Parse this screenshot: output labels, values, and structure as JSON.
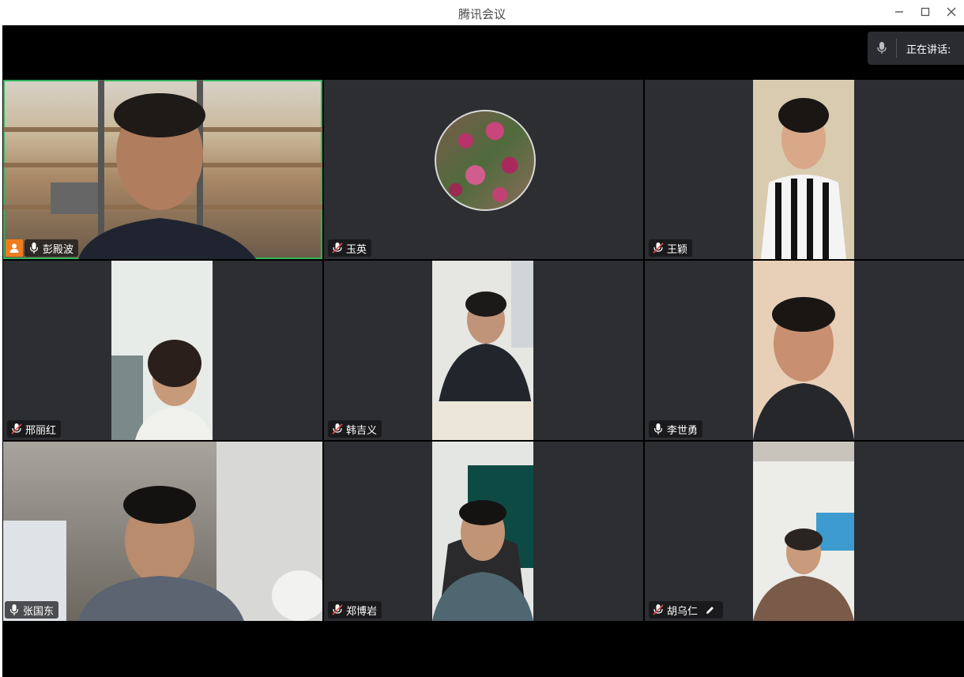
{
  "window": {
    "title": "腾讯会议",
    "minimize_icon": "minimize-icon",
    "maximize_icon": "maximize-icon",
    "close_icon": "close-icon"
  },
  "speaking": {
    "label": "正在讲话:",
    "icon": "mic-icon"
  },
  "participants": [
    {
      "name": "彭殿波",
      "mic": "on",
      "host": true,
      "active": true
    },
    {
      "name": "玉英",
      "mic": "muted",
      "avatar": true
    },
    {
      "name": "王颖",
      "mic": "muted"
    },
    {
      "name": "邢丽红",
      "mic": "muted"
    },
    {
      "name": "韩吉义",
      "mic": "muted"
    },
    {
      "name": "李世勇",
      "mic": "on"
    },
    {
      "name": "张国东",
      "mic": "on"
    },
    {
      "name": "郑博岩",
      "mic": "muted"
    },
    {
      "name": "胡乌仁",
      "mic": "muted",
      "editing": true
    }
  ],
  "colors": {
    "active_border": "#2fb45a",
    "host_badge": "#f07c1e",
    "tile_bg": "#2c2e31",
    "mute_red": "#e24b4b"
  }
}
